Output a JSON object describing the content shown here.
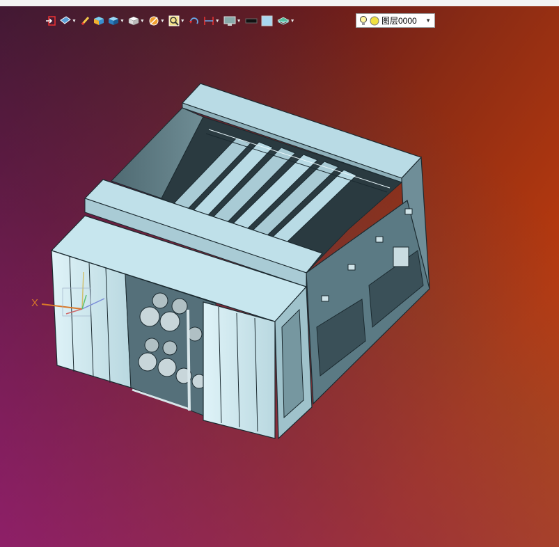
{
  "toolbar": {
    "items": [
      {
        "icon": "exit-sketch-icon",
        "has_menu": false
      },
      {
        "icon": "view-orientation-icon",
        "has_menu": true
      },
      {
        "icon": "pencil-icon",
        "has_menu": false
      },
      {
        "icon": "display-style-icon",
        "has_menu": false
      },
      {
        "icon": "shaded-box-icon",
        "has_menu": true
      },
      {
        "icon": "white-box-icon",
        "has_menu": true
      },
      {
        "icon": "section-view-icon",
        "has_menu": true
      },
      {
        "icon": "zoom-icon",
        "has_menu": true
      },
      {
        "icon": "rotate-icon",
        "has_menu": false
      },
      {
        "icon": "dimension-icon",
        "has_menu": true
      },
      {
        "icon": "monitor-icon",
        "has_menu": true
      },
      {
        "icon": "line-color-icon",
        "has_menu": false
      },
      {
        "icon": "fill-color-icon",
        "has_menu": false
      },
      {
        "icon": "layers-icon",
        "has_menu": true
      }
    ],
    "layer": {
      "label": "图层0000",
      "icons": [
        "bulb-icon",
        "layer-color-icon"
      ],
      "dropdown": "chevron-down-icon"
    }
  },
  "viewport": {
    "triad_x_label": "X",
    "background_colors": [
      "#2e0a1a",
      "#8a2b14",
      "#c44610",
      "#8c1f76"
    ]
  }
}
